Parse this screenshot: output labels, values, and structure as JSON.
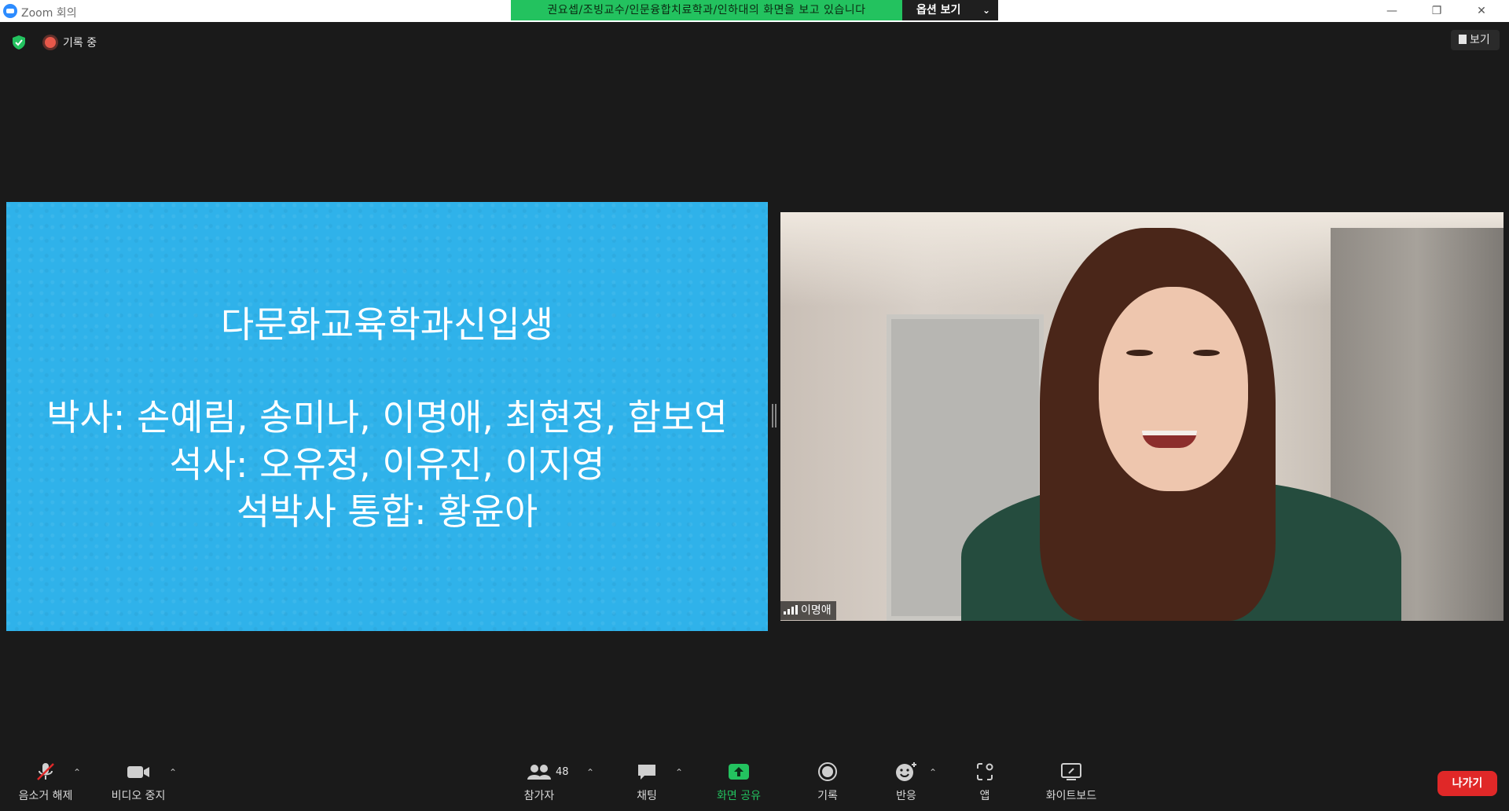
{
  "window": {
    "title": "Zoom 회의",
    "share_banner": "권요셉/조빙교수/인문융합치료학과/인하대의 화면을 보고 있습니다",
    "view_options": "옵션 보기",
    "controls": [
      "—",
      "❐",
      "✕"
    ]
  },
  "status": {
    "recording": "기록 중",
    "view_button": "보기"
  },
  "slide": {
    "title": "다문화교육학과신입생",
    "lines": [
      "박사: 손예림, 송미나, 이명애, 최현정, 함보연",
      "석사: 오유정, 이유진, 이지영",
      "석박사 통합: 황윤아"
    ],
    "background_color": "#2fb2ea"
  },
  "video": {
    "participant_name": "이명애"
  },
  "toolbar": {
    "mute": "음소거 해제",
    "video": "비디오 중지",
    "participants": "참가자",
    "participants_count": "48",
    "chat": "채팅",
    "share": "화면 공유",
    "record": "기록",
    "reactions": "반응",
    "apps": "앱",
    "whiteboard": "화이트보드",
    "leave": "나가기",
    "share_color": "#23c25f",
    "leave_color": "#e02828"
  }
}
